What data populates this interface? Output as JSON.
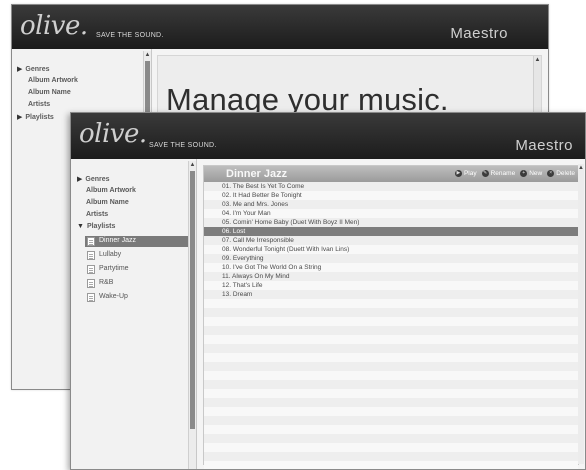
{
  "back_window": {
    "logo": "olive.",
    "tagline": "SAVE THE SOUND.",
    "app_name": "Maestro",
    "sidebar": [
      "Genres",
      "Album Artwork",
      "Album Name",
      "Artists",
      "Playlists"
    ],
    "heading": "Manage your music."
  },
  "front_window": {
    "logo": "olive.",
    "tagline": "SAVE THE SOUND.",
    "app_name": "Maestro",
    "sidebar": {
      "genres": "Genres",
      "album_artwork": "Album Artwork",
      "album_name": "Album Name",
      "artists": "Artists",
      "playlists": "Playlists",
      "playlist_items": [
        "Dinner Jazz",
        "Lullaby",
        "Partytime",
        "R&B",
        "Wake-Up"
      ],
      "selected_playlist": "Dinner Jazz"
    },
    "playlist": {
      "title": "Dinner Jazz",
      "actions": {
        "play": "Play",
        "rename": "Rename",
        "new": "New",
        "delete": "Delete"
      },
      "tracks": [
        "01. The Best Is Yet To Come",
        "02. It Had Better Be Tonight",
        "03. Me and Mrs. Jones",
        "04. I'm Your Man",
        "05. Comin' Home Baby (Duet With Boyz II Men)",
        "06. Lost",
        "07. Call Me Irresponsible",
        "08. Wonderful Tonight (Duett With Ivan Lins)",
        "09. Everything",
        "10. I've Got The World On a String",
        "11. Always On My Mind",
        "12. That's Life",
        "13. Dream"
      ],
      "selected_track": "06. Lost"
    },
    "colors": {
      "titlebar": "#1c1c1c",
      "selection": "#7d7d7d",
      "header": "#9b9b9b"
    }
  }
}
